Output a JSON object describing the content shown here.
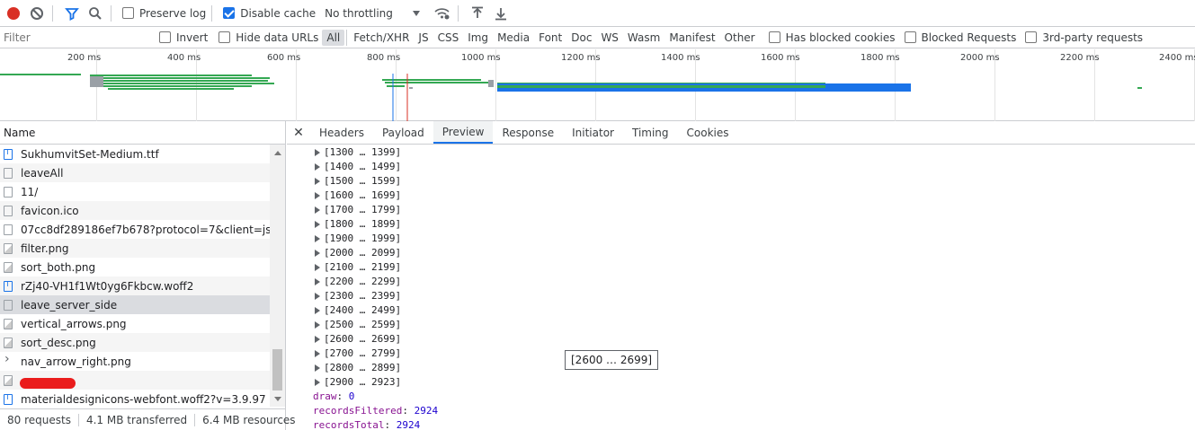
{
  "toolbar": {
    "preserve_log": {
      "label": "Preserve log",
      "checked": false
    },
    "disable_cache": {
      "label": "Disable cache",
      "checked": true
    },
    "throttling": "No throttling"
  },
  "filterbar": {
    "placeholder": "Filter",
    "invert": "Invert",
    "hide_data_urls": "Hide data URLs",
    "types": [
      "All",
      "Fetch/XHR",
      "JS",
      "CSS",
      "Img",
      "Media",
      "Font",
      "Doc",
      "WS",
      "Wasm",
      "Manifest",
      "Other"
    ],
    "has_blocked_cookies": "Has blocked cookies",
    "blocked_requests": "Blocked Requests",
    "third_party": "3rd-party requests"
  },
  "overview": {
    "ticks": [
      "200 ms",
      "400 ms",
      "600 ms",
      "800 ms",
      "1000 ms",
      "1200 ms",
      "1400 ms",
      "1600 ms",
      "1800 ms",
      "2000 ms",
      "2200 ms",
      "2400 ms"
    ]
  },
  "requests": {
    "header": "Name",
    "items": [
      {
        "name": "SukhumvitSet-Medium.ttf",
        "kind": "font"
      },
      {
        "name": "leaveAll",
        "kind": "doc"
      },
      {
        "name": "11/",
        "kind": "doc"
      },
      {
        "name": "favicon.ico",
        "kind": "doc"
      },
      {
        "name": "07cc8df289186ef7b678?protocol=7&client=js&versi",
        "kind": "doc"
      },
      {
        "name": "filter.png",
        "kind": "img"
      },
      {
        "name": "sort_both.png",
        "kind": "img"
      },
      {
        "name": "rZj40-VH1f1Wt0yg6Fkbcw.woff2",
        "kind": "font"
      },
      {
        "name": "leave_server_side",
        "kind": "doc"
      },
      {
        "name": "vertical_arrows.png",
        "kind": "img"
      },
      {
        "name": "sort_desc.png",
        "kind": "img"
      },
      {
        "name": "nav_arrow_right.png",
        "kind": "arrow"
      },
      {
        "name": "",
        "kind": "img"
      },
      {
        "name": "materialdesignicons-webfont.woff2?v=3.9.97",
        "kind": "font"
      }
    ],
    "selected_index": 8
  },
  "status": {
    "requests": "80 requests",
    "transferred": "4.1 MB transferred",
    "resources": "6.4 MB resources"
  },
  "detail": {
    "tabs": [
      "Headers",
      "Payload",
      "Preview",
      "Response",
      "Initiator",
      "Timing",
      "Cookies"
    ],
    "active_tab": "Preview",
    "ranges": [
      "[1300 … 1399]",
      "[1400 … 1499]",
      "[1500 … 1599]",
      "[1600 … 1699]",
      "[1700 … 1799]",
      "[1800 … 1899]",
      "[1900 … 1999]",
      "[2000 … 2099]",
      "[2100 … 2199]",
      "[2200 … 2299]",
      "[2300 … 2399]",
      "[2400 … 2499]",
      "[2500 … 2599]",
      "[2600 … 2699]",
      "[2700 … 2799]",
      "[2800 … 2899]",
      "[2900 … 2923]"
    ],
    "fields": [
      {
        "key": "draw",
        "value": "0"
      },
      {
        "key": "recordsFiltered",
        "value": "2924"
      },
      {
        "key": "recordsTotal",
        "value": "2924"
      }
    ],
    "tooltip": "[2600 … 2699]"
  },
  "colors": {
    "record": "#d93025",
    "accent": "#1a73e8",
    "bar_green": "#34a853",
    "bar_blue": "#1a73e8"
  }
}
